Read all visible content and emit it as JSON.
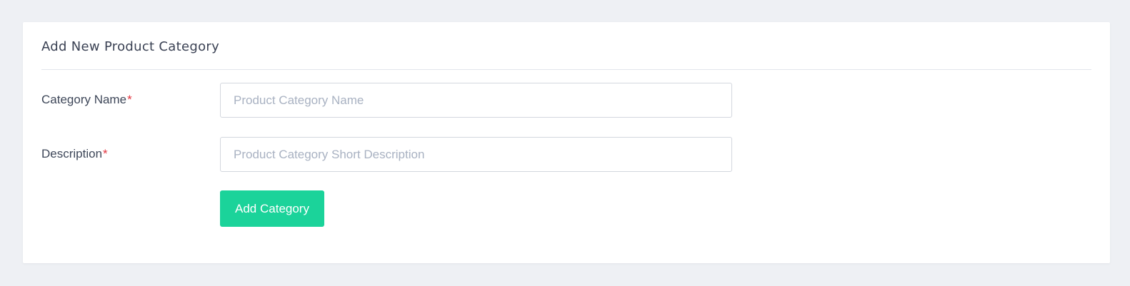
{
  "form": {
    "title": "Add New Product Category",
    "required_marker": "*",
    "fields": [
      {
        "label": "Category Name",
        "placeholder": "Product Category Name",
        "value": ""
      },
      {
        "label": "Description",
        "placeholder": "Product Category Short Description",
        "value": ""
      }
    ],
    "submit_label": "Add Category"
  },
  "colors": {
    "page_background": "#eef0f4",
    "card_background": "#ffffff",
    "accent_button": "#1bd39a",
    "required_marker": "#e3343f",
    "placeholder_text": "#a9b2c2"
  }
}
